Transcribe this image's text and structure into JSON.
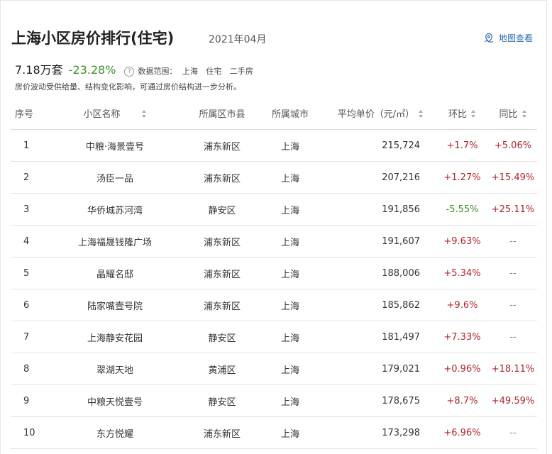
{
  "header": {
    "title": "上海小区房价排行(住宅)",
    "month": "2021年04月",
    "map_link": "地图查看"
  },
  "summary": {
    "count": "7.18万套",
    "change": "-23.28%",
    "scope_label": "数据范围：",
    "scope_values": [
      "上海",
      "住宅",
      "二手房"
    ],
    "note": "房价波动受供给量、结构变化影响，可通过房价结构进一步分析。"
  },
  "table": {
    "columns": [
      "序号",
      "小区名称",
      "所属区市县",
      "所属城市",
      "平均单价（元/㎡）",
      "环比",
      "同比"
    ],
    "rows": [
      [
        "1",
        "中粮·海景壹号",
        "浦东新区",
        "上海",
        "215,724",
        "+1.7%",
        "+5.06%"
      ],
      [
        "2",
        "汤臣一品",
        "浦东新区",
        "上海",
        "207,216",
        "+1.27%",
        "+15.49%"
      ],
      [
        "3",
        "华侨城苏河湾",
        "静安区",
        "上海",
        "191,856",
        "-5.55%",
        "+25.11%"
      ],
      [
        "4",
        "上海福晟钱隆广场",
        "浦东新区",
        "上海",
        "191,607",
        "+9.63%",
        "--"
      ],
      [
        "5",
        "晶耀名邸",
        "浦东新区",
        "上海",
        "188,006",
        "+5.34%",
        "--"
      ],
      [
        "6",
        "陆家嘴壹号院",
        "浦东新区",
        "上海",
        "185,862",
        "+9.6%",
        "--"
      ],
      [
        "7",
        "上海静安花园",
        "静安区",
        "上海",
        "181,497",
        "+7.33%",
        "--"
      ],
      [
        "8",
        "翠湖天地",
        "黄浦区",
        "上海",
        "179,021",
        "+0.96%",
        "+18.11%"
      ],
      [
        "9",
        "中粮天悦壹号",
        "静安区",
        "上海",
        "178,675",
        "+8.7%",
        "+49.59%"
      ],
      [
        "10",
        "东方悦耀",
        "浦东新区",
        "上海",
        "173,298",
        "+6.96%",
        "--"
      ]
    ]
  },
  "colors": {
    "positive": "#b0252e",
    "negative": "#3f8f2a",
    "link": "#2b6bb2"
  },
  "icons": {
    "map": "map-pin-icon",
    "help": "question-circle-icon",
    "sort": "sort-arrows-icon"
  }
}
